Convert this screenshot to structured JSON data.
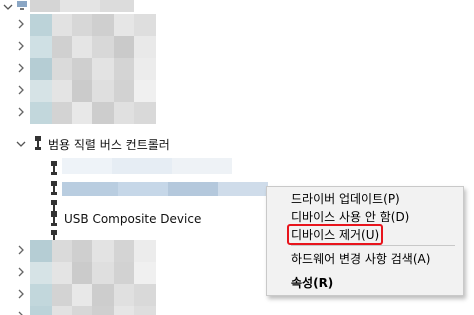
{
  "tree": {
    "category_label": "범용 직렬 버스 컨트롤러",
    "visible_device_label": "USB Composite Device"
  },
  "context_menu": {
    "items": [
      {
        "label": "드라이버 업데이트(P)",
        "bold": false
      },
      {
        "label": "디바이스 사용 안 함(D)",
        "bold": false
      },
      {
        "label": "디바이스 제거(U)",
        "bold": false,
        "highlighted": true
      },
      {
        "label": "하드웨어 변경 사항 검색(A)",
        "bold": false
      },
      {
        "label": "속성(R)",
        "bold": true
      }
    ]
  },
  "highlight_color": "#e8141c",
  "menu_background": "#f2f2f2"
}
